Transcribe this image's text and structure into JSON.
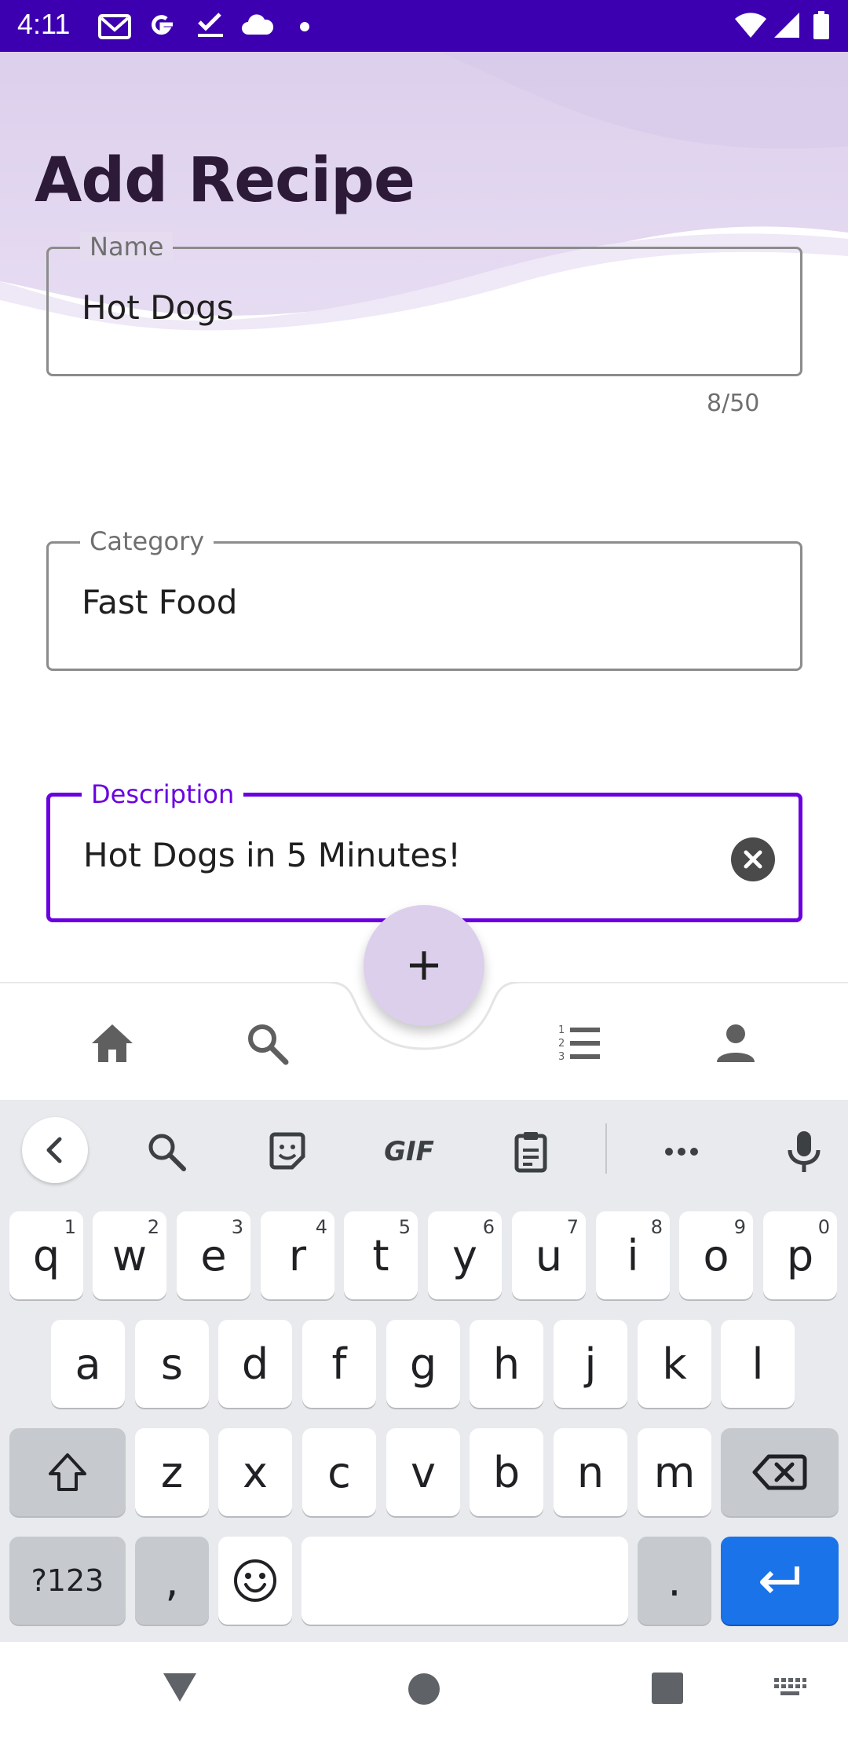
{
  "status_bar": {
    "time": "4:11",
    "left_icons": [
      "gmail-icon",
      "google-icon",
      "task-check-icon",
      "cloud-icon",
      "dot-icon"
    ],
    "right_icons": [
      "wifi-icon",
      "cellular-signal-icon",
      "battery-icon"
    ]
  },
  "page": {
    "title": "Add Recipe"
  },
  "form": {
    "name": {
      "label": "Name",
      "value": "Hot Dogs",
      "counter": "8/50"
    },
    "category": {
      "label": "Category",
      "value": "Fast Food"
    },
    "description": {
      "label": "Description",
      "value": "Hot Dogs in 5 Minutes!"
    }
  },
  "bottom_nav": {
    "items": [
      "home-icon",
      "search-icon",
      "list-icon",
      "person-icon"
    ],
    "fab": "+"
  },
  "keyboard": {
    "toolbar": [
      "back-icon",
      "search-icon",
      "sticker-icon",
      "GIF",
      "clipboard-icon",
      "more-icon",
      "mic-icon"
    ],
    "gif_label": "GIF",
    "row1": [
      {
        "k": "q",
        "h": "1"
      },
      {
        "k": "w",
        "h": "2"
      },
      {
        "k": "e",
        "h": "3"
      },
      {
        "k": "r",
        "h": "4"
      },
      {
        "k": "t",
        "h": "5"
      },
      {
        "k": "y",
        "h": "6"
      },
      {
        "k": "u",
        "h": "7"
      },
      {
        "k": "i",
        "h": "8"
      },
      {
        "k": "o",
        "h": "9"
      },
      {
        "k": "p",
        "h": "0"
      }
    ],
    "row2": [
      "a",
      "s",
      "d",
      "f",
      "g",
      "h",
      "j",
      "k",
      "l"
    ],
    "row3": [
      "z",
      "x",
      "c",
      "v",
      "b",
      "n",
      "m"
    ],
    "symbols_label": "?123",
    "comma": ",",
    "period": ".",
    "accent_color": "#1a73e8"
  },
  "colors": {
    "status_bar": "#3d00b0",
    "focus": "#6a00e0",
    "fab": "#dccfec",
    "title": "#2c1a38"
  }
}
